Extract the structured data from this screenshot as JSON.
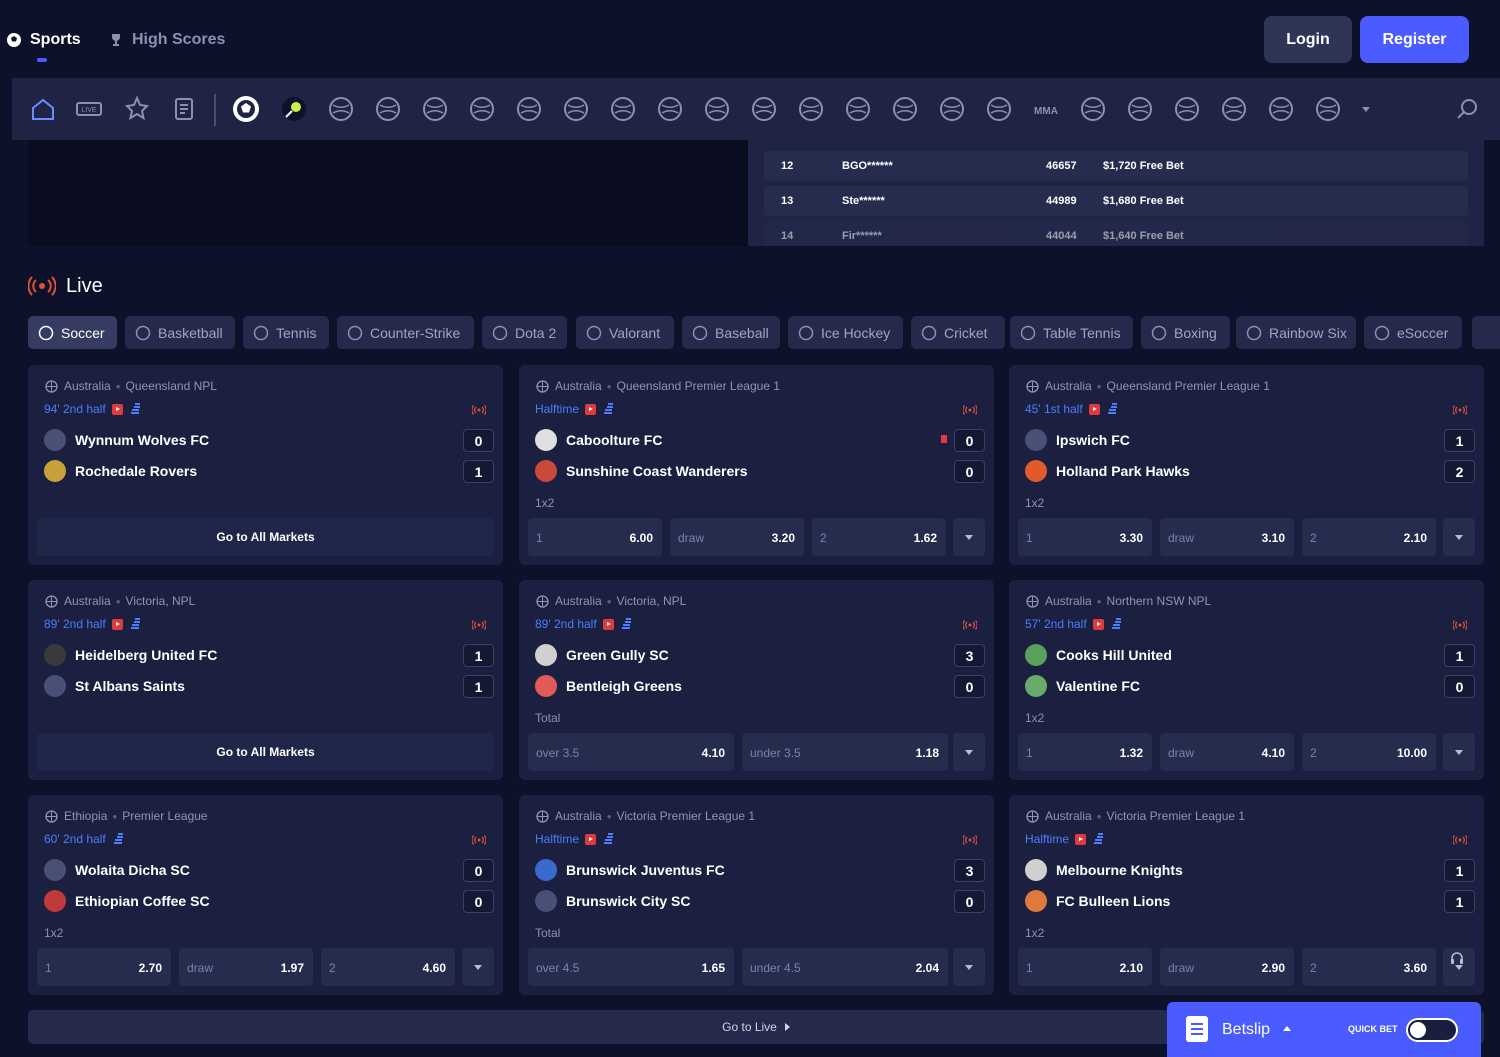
{
  "header": {
    "sports": "Sports",
    "high_scores": "High Scores",
    "login": "Login",
    "register": "Register"
  },
  "scores_table": [
    {
      "rank": "12",
      "user": "BGO******",
      "points": "46657",
      "prize": "$1,720 Free Bet"
    },
    {
      "rank": "13",
      "user": "Ste******",
      "points": "44989",
      "prize": "$1,680 Free Bet"
    },
    {
      "rank": "14",
      "user": "Fir******",
      "points": "44044",
      "prize": "$1,640 Free Bet"
    }
  ],
  "live": {
    "title": "Live"
  },
  "chips": [
    "Soccer",
    "Basketball",
    "Tennis",
    "Counter-Strike",
    "Dota 2",
    "Valorant",
    "Baseball",
    "Ice Hockey",
    "Cricket",
    "Table Tennis",
    "Boxing",
    "Rainbow Six",
    "eSoccer"
  ],
  "cards": [
    {
      "country": "Australia",
      "league": "Queensland NPL",
      "status": "94' 2nd half",
      "teams": [
        {
          "name": "Wynnum Wolves FC",
          "score": "0"
        },
        {
          "name": "Rochedale Rovers",
          "score": "1"
        }
      ],
      "go_markets": "Go to All Markets"
    },
    {
      "country": "Australia",
      "league": "Queensland Premier League 1",
      "status": "Halftime",
      "teams": [
        {
          "name": "Caboolture FC",
          "score": "0"
        },
        {
          "name": "Sunshine Coast Wanderers",
          "score": "0"
        }
      ],
      "market": "1x2",
      "odds": [
        {
          "l": "1",
          "v": "6.00"
        },
        {
          "l": "draw",
          "v": "3.20"
        },
        {
          "l": "2",
          "v": "1.62"
        }
      ]
    },
    {
      "country": "Australia",
      "league": "Queensland Premier League 1",
      "status": "45' 1st half",
      "teams": [
        {
          "name": "Ipswich FC",
          "score": "1"
        },
        {
          "name": "Holland Park Hawks",
          "score": "2"
        }
      ],
      "market": "1x2",
      "odds": [
        {
          "l": "1",
          "v": "3.30"
        },
        {
          "l": "draw",
          "v": "3.10"
        },
        {
          "l": "2",
          "v": "2.10"
        }
      ]
    },
    {
      "country": "Australia",
      "league": "Victoria, NPL",
      "status": "89' 2nd half",
      "teams": [
        {
          "name": "Heidelberg United FC",
          "score": "1"
        },
        {
          "name": "St Albans Saints",
          "score": "1"
        }
      ],
      "go_markets": "Go to All Markets"
    },
    {
      "country": "Australia",
      "league": "Victoria, NPL",
      "status": "89' 2nd half",
      "teams": [
        {
          "name": "Green Gully SC",
          "score": "3"
        },
        {
          "name": "Bentleigh Greens",
          "score": "0"
        }
      ],
      "market": "Total",
      "odds": [
        {
          "l": "over 3.5",
          "v": "4.10"
        },
        {
          "l": "under 3.5",
          "v": "1.18"
        }
      ]
    },
    {
      "country": "Australia",
      "league": "Northern NSW NPL",
      "status": "57' 2nd half",
      "teams": [
        {
          "name": "Cooks Hill United",
          "score": "1"
        },
        {
          "name": "Valentine FC",
          "score": "0"
        }
      ],
      "market": "1x2",
      "odds": [
        {
          "l": "1",
          "v": "1.32"
        },
        {
          "l": "draw",
          "v": "4.10"
        },
        {
          "l": "2",
          "v": "10.00"
        }
      ]
    },
    {
      "country": "Ethiopia",
      "league": "Premier League",
      "status": "60' 2nd half",
      "teams": [
        {
          "name": "Wolaita Dicha SC",
          "score": "0"
        },
        {
          "name": "Ethiopian Coffee SC",
          "score": "0"
        }
      ],
      "market": "1x2",
      "odds": [
        {
          "l": "1",
          "v": "2.70"
        },
        {
          "l": "draw",
          "v": "1.97"
        },
        {
          "l": "2",
          "v": "4.60"
        }
      ]
    },
    {
      "country": "Australia",
      "league": "Victoria Premier League 1",
      "status": "Halftime",
      "teams": [
        {
          "name": "Brunswick Juventus FC",
          "score": "3"
        },
        {
          "name": "Brunswick City SC",
          "score": "0"
        }
      ],
      "market": "Total",
      "odds": [
        {
          "l": "over 4.5",
          "v": "1.65"
        },
        {
          "l": "under 4.5",
          "v": "2.04"
        }
      ]
    },
    {
      "country": "Australia",
      "league": "Victoria Premier League 1",
      "status": "Halftime",
      "teams": [
        {
          "name": "Melbourne Knights",
          "score": "1"
        },
        {
          "name": "FC Bulleen Lions",
          "score": "1"
        }
      ],
      "market": "1x2",
      "odds": [
        {
          "l": "1",
          "v": "2.10"
        },
        {
          "l": "draw",
          "v": "2.90"
        },
        {
          "l": "2",
          "v": "3.60"
        }
      ]
    }
  ],
  "go_live": "Go to Live",
  "betslip": {
    "label": "Betslip",
    "quick_bet": "QUICK BET"
  },
  "colors": {
    "bg": "#0d1129",
    "card": "#1b2040",
    "accent": "#4a5cff",
    "live_red": "#e03a3a",
    "status_blue": "#4a7dff"
  }
}
